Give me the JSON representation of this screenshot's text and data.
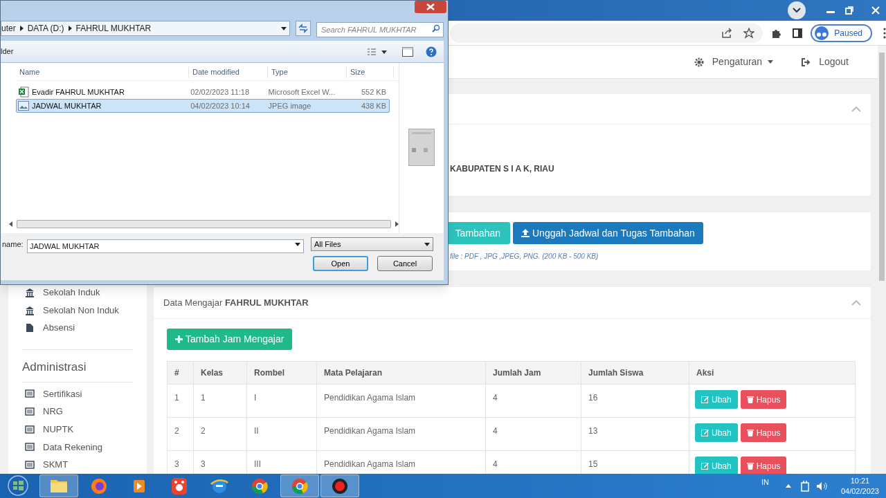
{
  "browser": {
    "profile_button": "Paused"
  },
  "navbar": {
    "items": [
      {
        "label": "Pengaturan",
        "kind": "settings"
      },
      {
        "label": "Logout",
        "kind": "logout"
      }
    ]
  },
  "sidebar": {
    "items": [
      {
        "label": "Sekolah Induk",
        "kind": "institution"
      },
      {
        "label": "Sekolah Non Induk",
        "kind": "institution"
      },
      {
        "label": "Absensi",
        "kind": "file"
      }
    ],
    "heading": "Administrasi",
    "admin_items": [
      {
        "label": "Sertifikasi",
        "kind": "list"
      },
      {
        "label": "NRG",
        "kind": "list"
      },
      {
        "label": "NUPTK",
        "kind": "list"
      },
      {
        "label": "Data Rekening",
        "kind": "list"
      },
      {
        "label": "SKMT",
        "kind": "list"
      }
    ]
  },
  "school_card": {
    "text": "KABUPATEN S I A K, RIAU"
  },
  "upload_card": {
    "buttons": [
      {
        "label": "Tambahan",
        "kind": "teal"
      },
      {
        "label": "Unggah Jadwal dan Tugas Tambahan",
        "kind": "upload"
      }
    ],
    "hint": "file : PDF , JPG ,JPEG, PNG. (200 KB - 500 KB)"
  },
  "teaching_card": {
    "title": "Data Mengajar **FAHRUL MUKHTAR**",
    "add_button": "Tambah Jam Mengajar",
    "table": {
      "columns": [
        "#",
        "Kelas",
        "Rombel",
        "Mata Pelajaran",
        "Jumlah Jam",
        "Jumlah Siswa",
        "Aksi"
      ],
      "rows": [
        {
          "cells": [
            "1",
            "1",
            "I",
            "Pendidikan Agama Islam",
            "4",
            "16"
          ],
          "actions": [
            "Ubah",
            "Hapus"
          ]
        },
        {
          "cells": [
            "2",
            "2",
            "II",
            "Pendidikan Agama Islam",
            "4",
            "13"
          ],
          "actions": [
            "Ubah",
            "Hapus"
          ]
        },
        {
          "cells": [
            "3",
            "3",
            "III",
            "Pendidikan Agama Islam",
            "4",
            "15"
          ],
          "actions": [
            "Ubah",
            "Hapus"
          ]
        }
      ]
    }
  },
  "dialog": {
    "breadcrumb": [
      "uter",
      "DATA (D:)",
      "FAHRUL MUKHTAR"
    ],
    "search": {
      "placeholder": "Search FAHRUL MUKHTAR"
    },
    "toolbar_label": "lder",
    "columns": [
      "Name",
      "Date modified",
      "Type",
      "Size"
    ],
    "files": [
      {
        "name": "Evadir FAHRUL MUKHTAR",
        "date": "02/02/2023 11:18",
        "type": "Microsoft Excel W...",
        "size": "552 KB",
        "kind": "spreadsheet",
        "selected": false
      },
      {
        "name": "JADWAL MUKHTAR",
        "date": "04/02/2023 10:14",
        "type": "JPEG image",
        "size": "438 KB",
        "kind": "image",
        "selected": true
      }
    ],
    "filename_label": "name:",
    "filename": "JADWAL MUKHTAR",
    "filter": "All Files",
    "buttons": [
      "Open",
      "Cancel"
    ]
  },
  "taskbar": {
    "apps": [
      {
        "kind": "folder",
        "running": true
      },
      {
        "kind": "firefox",
        "running": false
      },
      {
        "kind": "media",
        "running": false
      },
      {
        "kind": "red-app",
        "running": false
      },
      {
        "kind": "ie",
        "running": false
      },
      {
        "kind": "chrome",
        "running": false
      },
      {
        "kind": "chrome",
        "running": true
      },
      {
        "kind": "recorder",
        "running": true
      }
    ],
    "language": "IN",
    "time": "10:21",
    "date": "04/02/2023"
  }
}
